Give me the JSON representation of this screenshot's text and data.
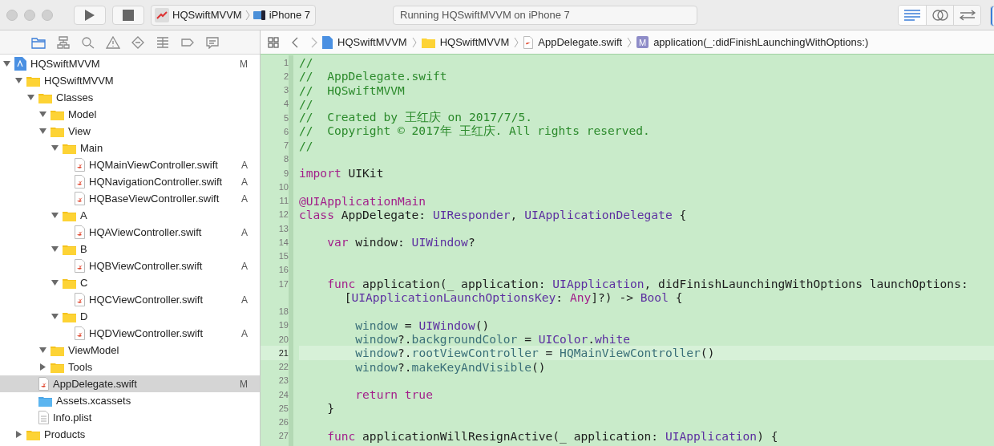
{
  "toolbar": {
    "scheme": {
      "project": "HQSwiftMVVM",
      "device": "iPhone 7"
    },
    "activity": "Running HQSwiftMVVM on iPhone 7",
    "editor_modes": [
      {
        "kind": "standard",
        "selected": true
      },
      {
        "kind": "assistant",
        "selected": false
      },
      {
        "kind": "version",
        "selected": false
      }
    ]
  },
  "navigator_tabs": [
    {
      "kind": "folder",
      "selected": true
    },
    {
      "kind": "hierarchy",
      "selected": false
    },
    {
      "kind": "search",
      "selected": false
    },
    {
      "kind": "warning",
      "selected": false
    },
    {
      "kind": "test",
      "selected": false
    },
    {
      "kind": "debug",
      "selected": false
    },
    {
      "kind": "breakpoint",
      "selected": false
    },
    {
      "kind": "report",
      "selected": false
    }
  ],
  "tree": [
    {
      "name": "HQSwiftMVVM",
      "kind": "project",
      "status": "M",
      "selected": false,
      "expanded": true,
      "children": [
        {
          "name": "HQSwiftMVVM",
          "kind": "folder",
          "selected": false,
          "expanded": true,
          "children": [
            {
              "name": "Classes",
              "kind": "folder",
              "selected": false,
              "expanded": true,
              "children": [
                {
                  "name": "Model",
                  "kind": "folder",
                  "selected": false,
                  "expanded": true
                },
                {
                  "name": "View",
                  "kind": "folder",
                  "selected": false,
                  "expanded": true,
                  "children": [
                    {
                      "name": "Main",
                      "kind": "folder",
                      "selected": false,
                      "expanded": true,
                      "children": [
                        {
                          "name": "HQMainViewController.swift",
                          "kind": "swift",
                          "status": "A",
                          "selected": false
                        },
                        {
                          "name": "HQNavigationController.swift",
                          "kind": "swift",
                          "status": "A",
                          "selected": false
                        },
                        {
                          "name": "HQBaseViewController.swift",
                          "kind": "swift",
                          "status": "A",
                          "selected": false
                        }
                      ]
                    },
                    {
                      "name": "A",
                      "kind": "folder",
                      "selected": false,
                      "expanded": true,
                      "children": [
                        {
                          "name": "HQAViewController.swift",
                          "kind": "swift",
                          "status": "A",
                          "selected": false
                        }
                      ]
                    },
                    {
                      "name": "B",
                      "kind": "folder",
                      "selected": false,
                      "expanded": true,
                      "children": [
                        {
                          "name": "HQBViewController.swift",
                          "kind": "swift",
                          "status": "A",
                          "selected": false
                        }
                      ]
                    },
                    {
                      "name": "C",
                      "kind": "folder",
                      "selected": false,
                      "expanded": true,
                      "children": [
                        {
                          "name": "HQCViewController.swift",
                          "kind": "swift",
                          "status": "A",
                          "selected": false
                        }
                      ]
                    },
                    {
                      "name": "D",
                      "kind": "folder",
                      "selected": false,
                      "expanded": true,
                      "children": [
                        {
                          "name": "HQDViewController.swift",
                          "kind": "swift",
                          "status": "A",
                          "selected": false
                        }
                      ]
                    }
                  ]
                },
                {
                  "name": "ViewModel",
                  "kind": "folder",
                  "selected": false,
                  "expanded": true
                },
                {
                  "name": "Tools",
                  "kind": "folder",
                  "selected": false,
                  "expanded": false
                }
              ]
            },
            {
              "name": "AppDelegate.swift",
              "kind": "swift",
              "status": "M",
              "selected": true
            },
            {
              "name": "Assets.xcassets",
              "kind": "assets",
              "selected": false
            },
            {
              "name": "Info.plist",
              "kind": "plist",
              "selected": false
            }
          ]
        },
        {
          "name": "Products",
          "kind": "folder",
          "selected": false,
          "expanded": false
        }
      ]
    }
  ],
  "jump_bar": [
    {
      "kind": "project",
      "text": "HQSwiftMVVM"
    },
    {
      "kind": "folder",
      "text": "HQSwiftMVVM"
    },
    {
      "kind": "swift",
      "text": "AppDelegate.swift"
    },
    {
      "kind": "method",
      "badge": "M",
      "text": "application(_:didFinishLaunchingWithOptions:)"
    }
  ],
  "code": [
    {
      "number": "1",
      "current": false,
      "tokens": [
        {
          "kind": "comment",
          "text": "//"
        }
      ]
    },
    {
      "number": "2",
      "current": false,
      "tokens": [
        {
          "kind": "comment",
          "text": "//  AppDelegate.swift"
        }
      ]
    },
    {
      "number": "3",
      "current": false,
      "tokens": [
        {
          "kind": "comment",
          "text": "//  HQSwiftMVVM"
        }
      ]
    },
    {
      "number": "4",
      "current": false,
      "tokens": [
        {
          "kind": "comment",
          "text": "//"
        }
      ]
    },
    {
      "number": "5",
      "current": false,
      "tokens": [
        {
          "kind": "comment",
          "text": "//  Created by 王红庆 on 2017/7/5."
        }
      ]
    },
    {
      "number": "6",
      "current": false,
      "tokens": [
        {
          "kind": "comment",
          "text": "//  Copyright © 2017年 王红庆. All rights reserved."
        }
      ]
    },
    {
      "number": "7",
      "current": false,
      "tokens": [
        {
          "kind": "comment",
          "text": "//"
        }
      ]
    },
    {
      "number": "8",
      "current": false
    },
    {
      "number": "9",
      "current": false,
      "tokens": [
        {
          "kind": "keyword",
          "text": "import"
        },
        {
          "kind": "plain",
          "text": " UIKit"
        }
      ]
    },
    {
      "number": "10",
      "current": false
    },
    {
      "number": "11",
      "current": false,
      "tokens": [
        {
          "kind": "keyword",
          "text": "@UIApplicationMain"
        }
      ]
    },
    {
      "number": "12",
      "current": false,
      "tokens": [
        {
          "kind": "keyword",
          "text": "class"
        },
        {
          "kind": "plain",
          "text": " AppDelegate: "
        },
        {
          "kind": "type",
          "text": "UIResponder"
        },
        {
          "kind": "plain",
          "text": ", "
        },
        {
          "kind": "type",
          "text": "UIApplicationDelegate"
        },
        {
          "kind": "plain",
          "text": " {"
        }
      ]
    },
    {
      "number": "13",
      "current": false
    },
    {
      "number": "14",
      "current": false,
      "tokens": [
        {
          "kind": "keyword",
          "text": "    var"
        },
        {
          "kind": "plain",
          "text": " window: "
        },
        {
          "kind": "type",
          "text": "UIWindow"
        },
        {
          "kind": "plain",
          "text": "?"
        }
      ]
    },
    {
      "number": "15",
      "current": false
    },
    {
      "number": "16",
      "current": false
    },
    {
      "number": "17",
      "current": false,
      "tokens": [
        {
          "kind": "keyword",
          "text": "    func"
        },
        {
          "kind": "plain",
          "text": " application(_ application: "
        },
        {
          "kind": "type",
          "text": "UIApplication"
        },
        {
          "kind": "plain",
          "text": ", didFinishLaunchingWithOptions launchOptions:"
        }
      ]
    },
    {
      "wrapped": true,
      "current": false,
      "tokens": [
        {
          "kind": "plain",
          "text": "      ["
        },
        {
          "kind": "type",
          "text": "UIApplicationLaunchOptionsKey"
        },
        {
          "kind": "plain",
          "text": ": "
        },
        {
          "kind": "keyword",
          "text": "Any"
        },
        {
          "kind": "plain",
          "text": "]?) -> "
        },
        {
          "kind": "type",
          "text": "Bool"
        },
        {
          "kind": "plain",
          "text": " {"
        }
      ]
    },
    {
      "number": "18",
      "current": false
    },
    {
      "number": "19",
      "current": false,
      "tokens": [
        {
          "kind": "ident",
          "text": "        window"
        },
        {
          "kind": "plain",
          "text": " = "
        },
        {
          "kind": "type",
          "text": "UIWindow"
        },
        {
          "kind": "plain",
          "text": "()"
        }
      ]
    },
    {
      "number": "20",
      "current": false,
      "tokens": [
        {
          "kind": "ident",
          "text": "        window"
        },
        {
          "kind": "plain",
          "text": "?."
        },
        {
          "kind": "ident",
          "text": "backgroundColor"
        },
        {
          "kind": "plain",
          "text": " = "
        },
        {
          "kind": "type",
          "text": "UIColor"
        },
        {
          "kind": "plain",
          "text": "."
        },
        {
          "kind": "type",
          "text": "white"
        }
      ]
    },
    {
      "number": "21",
      "current": true,
      "tokens": [
        {
          "kind": "ident",
          "text": "        window"
        },
        {
          "kind": "plain",
          "text": "?."
        },
        {
          "kind": "ident",
          "text": "rootViewController"
        },
        {
          "kind": "plain",
          "text": " = "
        },
        {
          "kind": "ident",
          "text": "HQMainViewController"
        },
        {
          "kind": "plain",
          "text": "()"
        }
      ]
    },
    {
      "number": "22",
      "current": false,
      "tokens": [
        {
          "kind": "ident",
          "text": "        window"
        },
        {
          "kind": "plain",
          "text": "?."
        },
        {
          "kind": "ident",
          "text": "makeKeyAndVisible"
        },
        {
          "kind": "plain",
          "text": "()"
        }
      ]
    },
    {
      "number": "23",
      "current": false
    },
    {
      "number": "24",
      "current": false,
      "tokens": [
        {
          "kind": "keyword",
          "text": "        return"
        },
        {
          "kind": "keyword",
          "text": " true"
        }
      ]
    },
    {
      "number": "25",
      "current": false,
      "tokens": [
        {
          "kind": "plain",
          "text": "    }"
        }
      ]
    },
    {
      "number": "26",
      "current": false
    },
    {
      "number": "27",
      "current": false,
      "tokens": [
        {
          "kind": "keyword",
          "text": "    func"
        },
        {
          "kind": "plain",
          "text": " applicationWillResignActive(_ application: "
        },
        {
          "kind": "type",
          "text": "UIApplication"
        },
        {
          "kind": "plain",
          "text": ") {"
        }
      ]
    }
  ]
}
